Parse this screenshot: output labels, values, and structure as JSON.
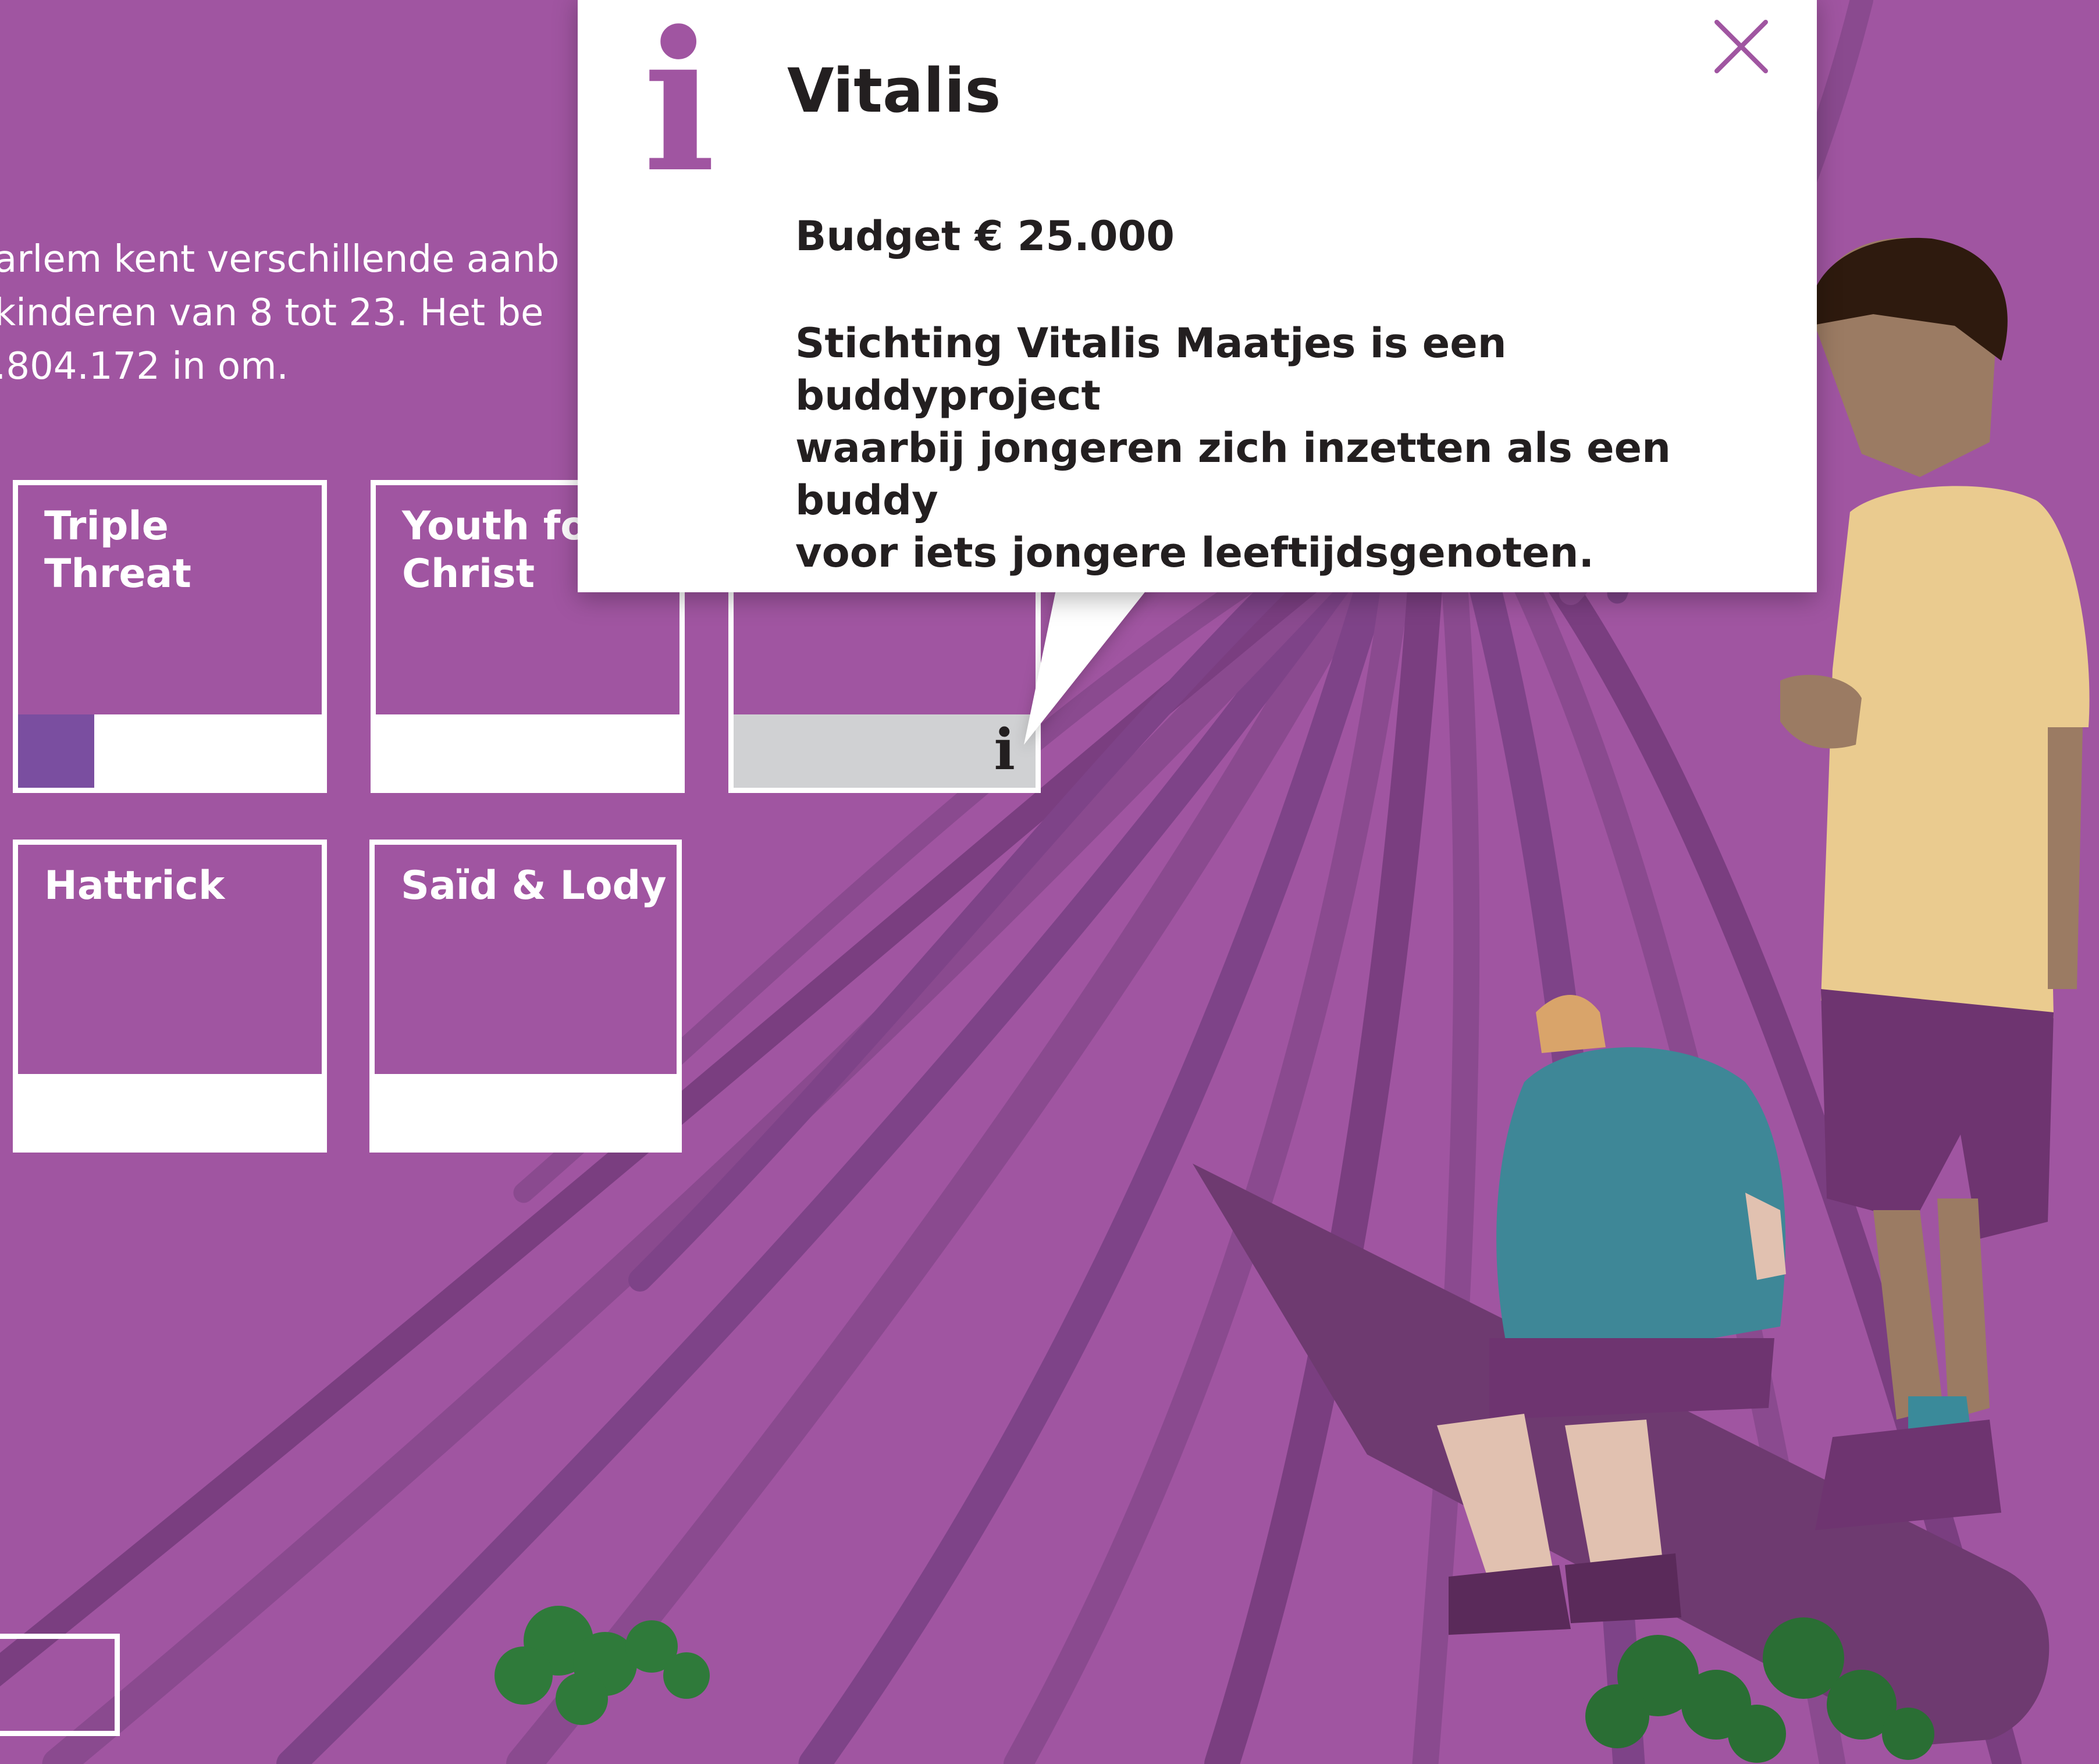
{
  "intro": {
    "line1": "arlem kent verschillende aanb",
    "line2": " kinderen van 8 tot 23. Het be",
    "line3": ".804.172 in om."
  },
  "cards": [
    {
      "title": "Triple Threat",
      "progress": 0.25
    },
    {
      "title": "Youth for\nChrist",
      "progress": 0
    },
    {
      "title": "",
      "progress": 0
    },
    {
      "title": "Hattrick",
      "progress": 0
    },
    {
      "title": "Saïd & Lody",
      "progress": 0
    }
  ],
  "popup": {
    "icon": "info-icon",
    "title": "Vitalis",
    "budget": "Budget € 25.000",
    "description": "Stichting Vitalis Maatjes is een buddyproject\nwaarbij jongeren zich inzetten als een buddy\nvoor iets jongere leeftijdsgenoten.",
    "close_icon": "close-icon"
  },
  "colors": {
    "background": "#a055a1",
    "card_border": "#ffffff",
    "accent": "#7a4ea0",
    "text_dark": "#231f20"
  }
}
